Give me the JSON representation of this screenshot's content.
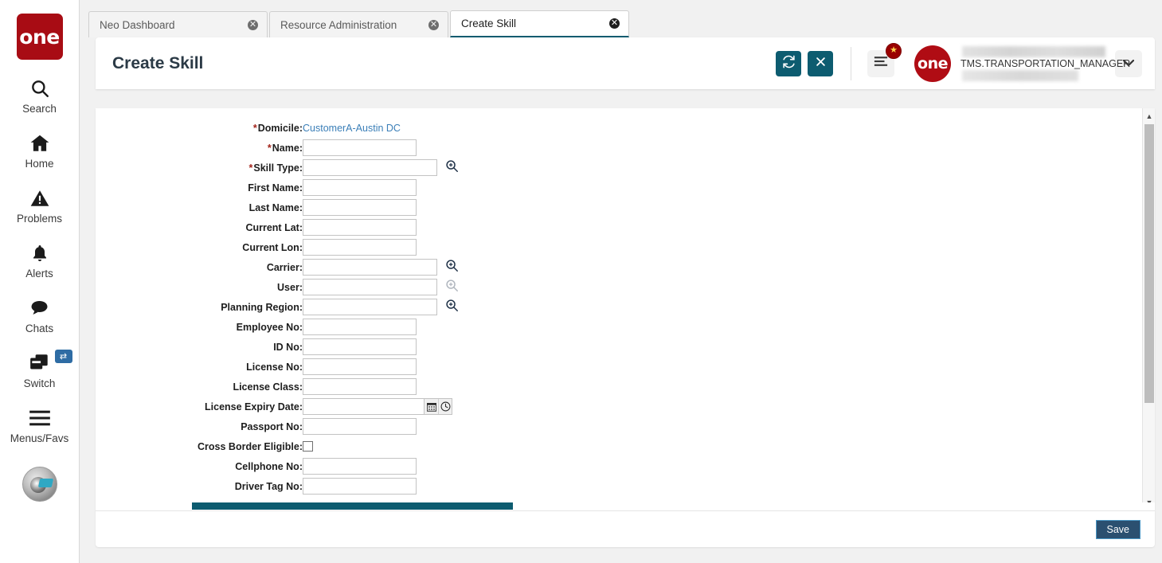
{
  "brand": {
    "logo_text": "one",
    "logo_color": "#a80c14"
  },
  "theme": {
    "accent_teal": "#0d5c70",
    "link_blue": "#3b7fb8",
    "required_red": "#a3241b",
    "save_blue": "#2b5070"
  },
  "sidebar": {
    "items": [
      {
        "label": "Search",
        "icon": "search-icon"
      },
      {
        "label": "Home",
        "icon": "home-icon"
      },
      {
        "label": "Problems",
        "icon": "warning-triangle-icon"
      },
      {
        "label": "Alerts",
        "icon": "bell-icon"
      },
      {
        "label": "Chats",
        "icon": "chat-bubble-icon"
      },
      {
        "label": "Switch",
        "icon": "windows-switch-icon",
        "badge": "⇄"
      },
      {
        "label": "Menus/Favs",
        "icon": "hamburger-icon"
      }
    ],
    "avatar": "user-avatar"
  },
  "tabs": [
    {
      "label": "Neo Dashboard",
      "active": false,
      "close": "✕"
    },
    {
      "label": "Resource Administration",
      "active": false,
      "close": "✕"
    },
    {
      "label": "Create Skill",
      "active": true,
      "close": "✕"
    }
  ],
  "header": {
    "title": "Create Skill",
    "refresh_icon": "refresh-icon",
    "close_icon": "close-icon",
    "menu_icon": "hamburger-menu-icon",
    "menu_badge_icon": "star-badge",
    "menu_badge_glyph": "★",
    "logo_text": "one",
    "user_name": "TMS.TRANSPORTATION_MANAGER",
    "caret_icon": "chevron-down-icon",
    "caret_glyph": "⌄"
  },
  "form": {
    "fields": [
      {
        "label": "Domicile",
        "required": true,
        "type": "link",
        "value": "CustomerA-Austin DC"
      },
      {
        "label": "Name",
        "required": true,
        "type": "text",
        "value": "",
        "width": "w143"
      },
      {
        "label": "Skill Type",
        "required": true,
        "type": "lookup",
        "value": "",
        "width": "w169",
        "lookup_enabled": true
      },
      {
        "label": "First Name",
        "required": false,
        "type": "text",
        "value": "",
        "width": "w143"
      },
      {
        "label": "Last Name",
        "required": false,
        "type": "text",
        "value": "",
        "width": "w143"
      },
      {
        "label": "Current Lat",
        "required": false,
        "type": "text",
        "value": "",
        "width": "w143"
      },
      {
        "label": "Current Lon",
        "required": false,
        "type": "text",
        "value": "",
        "width": "w143"
      },
      {
        "label": "Carrier",
        "required": false,
        "type": "lookup",
        "value": "",
        "width": "w169",
        "lookup_enabled": true
      },
      {
        "label": "User",
        "required": false,
        "type": "lookup",
        "value": "",
        "width": "w169",
        "lookup_enabled": false
      },
      {
        "label": "Planning Region",
        "required": false,
        "type": "lookup",
        "value": "",
        "width": "w169",
        "lookup_enabled": true
      },
      {
        "label": "Employee No",
        "required": false,
        "type": "text",
        "value": "",
        "width": "w143"
      },
      {
        "label": "ID No",
        "required": false,
        "type": "text",
        "value": "",
        "width": "w143"
      },
      {
        "label": "License No",
        "required": false,
        "type": "text",
        "value": "",
        "width": "w143"
      },
      {
        "label": "License Class",
        "required": false,
        "type": "text",
        "value": "",
        "width": "w143"
      },
      {
        "label": "License Expiry Date",
        "required": false,
        "type": "datetime",
        "value": "",
        "width": "w153"
      },
      {
        "label": "Passport No",
        "required": false,
        "type": "text",
        "value": "",
        "width": "w143"
      },
      {
        "label": "Cross Border Eligible",
        "required": false,
        "type": "checkbox",
        "checked": false
      },
      {
        "label": "Cellphone No",
        "required": false,
        "type": "text",
        "value": "",
        "width": "w143"
      },
      {
        "label": "Driver Tag No",
        "required": false,
        "type": "text",
        "value": "",
        "width": "w143"
      }
    ],
    "calendar_icon": "calendar-icon",
    "clock_icon": "clock-icon",
    "lookup_icon": "magnifier-plus-icon"
  },
  "scrollbars": {
    "vertical_up_glyph": "▲",
    "vertical_down_glyph": "▼"
  },
  "footer": {
    "save_label": "Save"
  }
}
